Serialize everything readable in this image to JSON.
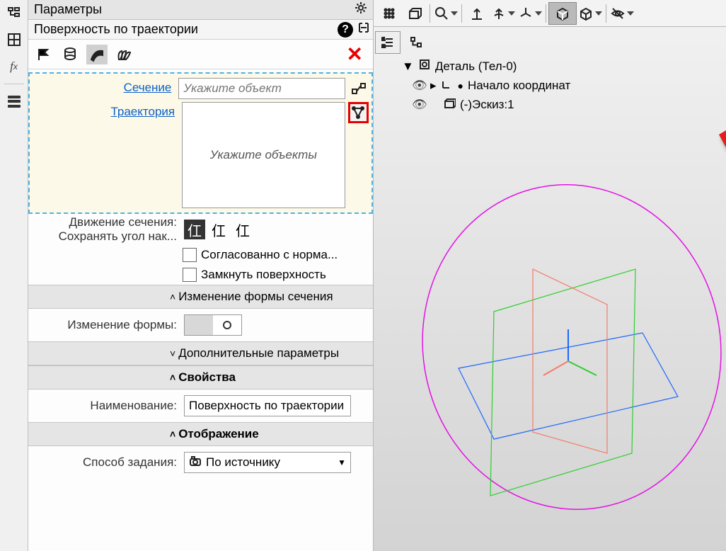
{
  "panel": {
    "title": "Параметры",
    "subtitle": "Поверхность по траектории",
    "section_label": "Сечение",
    "section_placeholder": "Укажите объект",
    "trajectory_label": "Траектория",
    "trajectory_placeholder": "Укажите объекты",
    "move_section_label": "Движение сечения:",
    "keep_angle_label": "Сохранять угол нак...",
    "chk_norm": "Согласованно с норма...",
    "chk_close": "Замкнуть поверхность",
    "change_form_head": "Изменение формы сечения",
    "change_form_label": "Изменение формы:",
    "extra_head": "Дополнительные параметры",
    "props_head": "Свойства",
    "name_label": "Наименование:",
    "name_value": "Поверхность по траектории",
    "display_head": "Отображение",
    "method_label": "Способ задания:",
    "method_value": "По источнику"
  },
  "tree": {
    "root": "Деталь (Тел-0)",
    "origin": "Начало координат",
    "sketch": "(-)Эскиз:1"
  }
}
